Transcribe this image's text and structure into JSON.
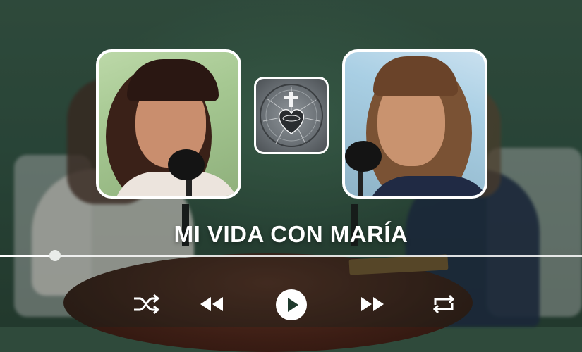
{
  "title": "MI VIDA CON MARÍA",
  "progress": {
    "fraction": 0.094
  },
  "controls": {
    "shuffle_icon": "shuffle-icon",
    "previous_icon": "rewind-icon",
    "play_icon": "play-icon",
    "next_icon": "fast-forward-icon",
    "repeat_icon": "repeat-icon"
  },
  "colors": {
    "background": "#2f4a3b",
    "accent": "#ffffff",
    "progress_knob": "#e9ece9"
  }
}
